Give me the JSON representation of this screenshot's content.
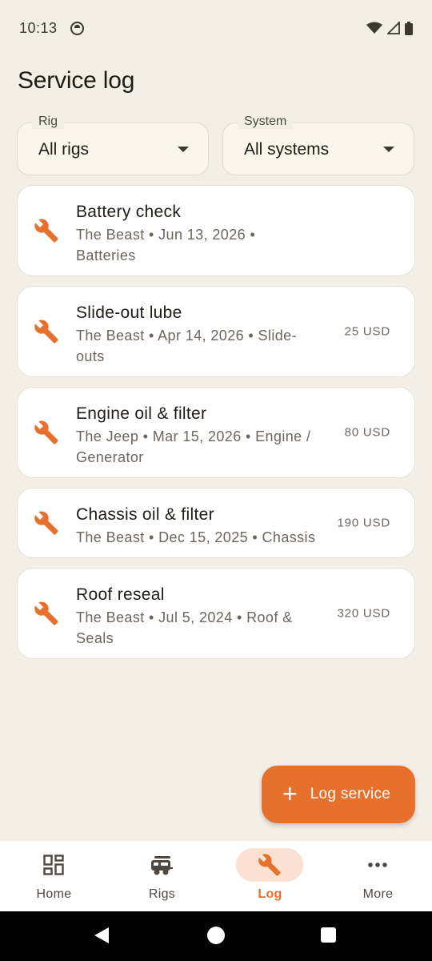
{
  "status_bar": {
    "time": "10:13"
  },
  "header": {
    "title": "Service log"
  },
  "filters": {
    "rig": {
      "label": "Rig",
      "value": "All rigs"
    },
    "system": {
      "label": "System",
      "value": "All systems"
    }
  },
  "entries": [
    {
      "title": "Battery check",
      "meta": "The Beast • Jun 13, 2026 • Batteries",
      "cost": ""
    },
    {
      "title": "Slide-out lube",
      "meta": "The Beast • Apr 14, 2026 • Slide-outs",
      "cost": "25 USD"
    },
    {
      "title": "Engine oil & filter",
      "meta": "The Jeep • Mar 15, 2026 • Engine / Generator",
      "cost": "80 USD"
    },
    {
      "title": "Chassis oil & filter",
      "meta": "The Beast • Dec 15, 2025 • Chassis",
      "cost": "190 USD"
    },
    {
      "title": "Roof reseal",
      "meta": "The Beast • Jul 5, 2024 • Roof & Seals",
      "cost": "320 USD"
    }
  ],
  "fab": {
    "icon": "plus-icon",
    "label": "Log service"
  },
  "nav": {
    "items": [
      {
        "label": "Home",
        "icon": "dashboard-icon",
        "active": false
      },
      {
        "label": "Rigs",
        "icon": "rv-icon",
        "active": false
      },
      {
        "label": "Log",
        "icon": "wrench-icon",
        "active": true
      },
      {
        "label": "More",
        "icon": "more-icon",
        "active": false
      }
    ]
  },
  "colors": {
    "accent": "#e8702d",
    "background": "#f3efe7",
    "card": "#ffffff",
    "active_nav_pill": "#fbe1d2"
  }
}
